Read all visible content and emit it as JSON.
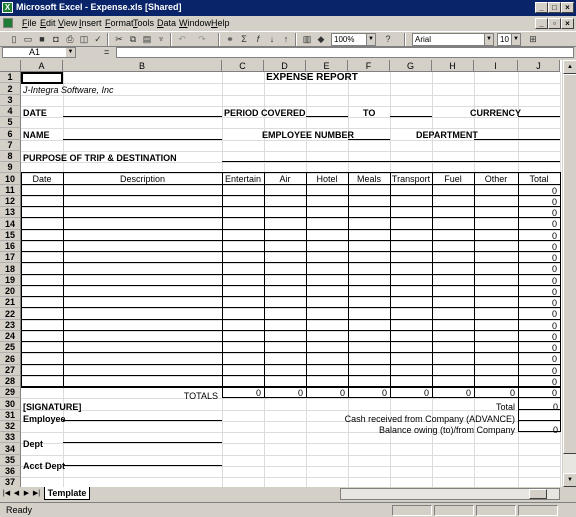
{
  "window": {
    "title": "Microsoft Excel - Expense.xls  [Shared]",
    "app_icon": "excel-icon"
  },
  "menu": [
    "File",
    "Edit",
    "View",
    "Insert",
    "Format",
    "Tools",
    "Data",
    "Window",
    "Help"
  ],
  "toolbar": {
    "zoom": "100%",
    "font": "Arial",
    "font_size": "10"
  },
  "formula_bar": {
    "cell_ref": "A1",
    "equals": "=",
    "value": ""
  },
  "columns": [
    "A",
    "B",
    "C",
    "D",
    "E",
    "F",
    "G",
    "H",
    "I",
    "J"
  ],
  "rows": [
    "1",
    "2",
    "3",
    "4",
    "5",
    "6",
    "7",
    "8",
    "9",
    "10",
    "11",
    "12",
    "13",
    "14",
    "15",
    "16",
    "17",
    "18",
    "19",
    "20",
    "21",
    "22",
    "23",
    "24",
    "25",
    "26",
    "27",
    "28",
    "29",
    "30",
    "31",
    "32",
    "33",
    "34",
    "35",
    "36",
    "37"
  ],
  "sheet": {
    "title": "EXPENSE REPORT",
    "company": "J-Integra Software, Inc",
    "date_label": "DATE",
    "period_label": "PERIOD COVERED",
    "to_label": "TO",
    "currency_label": "CURRENCY",
    "name_label": "NAME",
    "empno_label": "EMPLOYEE NUMBER",
    "dept_label": "DEPARTMENT",
    "purpose_label": "PURPOSE OF TRIP & DESTINATION",
    "table_headers": [
      "Date",
      "Description",
      "Entertain",
      "Air",
      "Hotel",
      "Meals",
      "Transport",
      "Fuel",
      "Other",
      "Total"
    ],
    "row_totals": [
      "0",
      "0",
      "0",
      "0",
      "0",
      "0",
      "0",
      "0",
      "0",
      "0",
      "0",
      "0",
      "0",
      "0",
      "0",
      "0",
      "0",
      "0"
    ],
    "totals_label": "TOTALS",
    "totals_values": [
      "0",
      "0",
      "0",
      "0",
      "0",
      "0",
      "0",
      "0"
    ],
    "signature_label": "[SIGNATURE]",
    "employee_label": "Employee",
    "dept_sig_label": "Dept",
    "acct_dept_label": "Acct Dept",
    "total_label": "Total",
    "total_value": "0",
    "advance_label": "Cash received from Company (ADVANCE)",
    "balance_label": "Balance owing (to)/from Company",
    "balance_value": "0"
  },
  "tab": {
    "name": "Template"
  },
  "status": {
    "text": "Ready"
  }
}
